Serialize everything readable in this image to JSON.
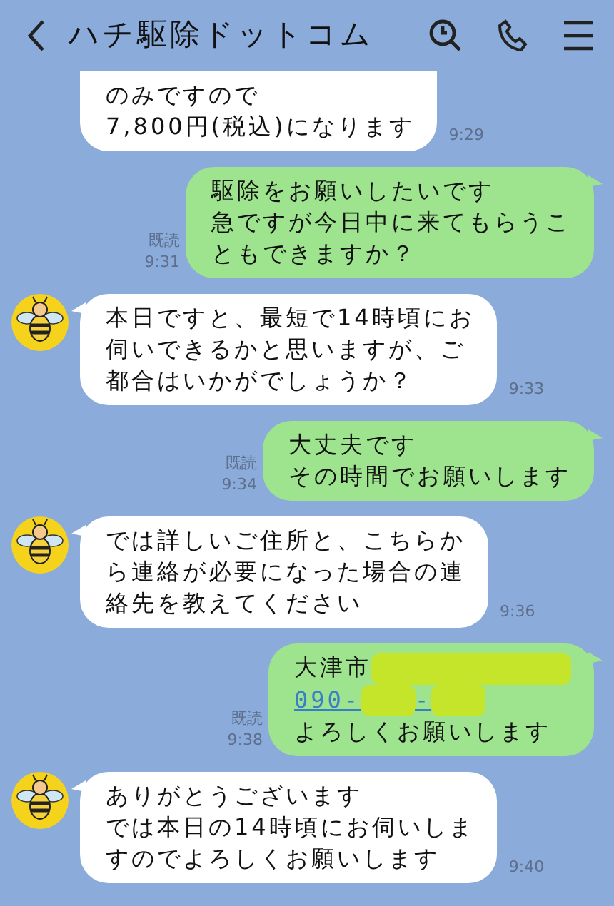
{
  "header": {
    "title": "ハチ駆除ドットコム"
  },
  "messages": [
    {
      "kind": "incoming",
      "avatar": false,
      "lines": [
        [
          {
            "kind": "text",
            "text": "のみですので"
          }
        ],
        [
          {
            "kind": "text",
            "text": "7,800円(税込)になります"
          }
        ]
      ],
      "time": "9:29"
    },
    {
      "kind": "outgoing",
      "read": "既読",
      "lines": [
        [
          {
            "kind": "text",
            "text": "駆除をお願いしたいです"
          }
        ],
        [
          {
            "kind": "text",
            "text": "急ですが今日中に来てもらうこ"
          }
        ],
        [
          {
            "kind": "text",
            "text": "ともできますか？"
          }
        ]
      ],
      "time": "9:31"
    },
    {
      "kind": "incoming",
      "avatar": true,
      "lines": [
        [
          {
            "kind": "text",
            "text": "本日ですと、最短で14時頃にお"
          }
        ],
        [
          {
            "kind": "text",
            "text": "伺いできるかと思いますが、ご"
          }
        ],
        [
          {
            "kind": "text",
            "text": "都合はいかがでしょうか？"
          }
        ]
      ],
      "time": "9:33"
    },
    {
      "kind": "outgoing",
      "read": "既読",
      "lines": [
        [
          {
            "kind": "text",
            "text": "大丈夫です"
          }
        ],
        [
          {
            "kind": "text",
            "text": "その時間でお願いします"
          }
        ]
      ],
      "time": "9:34"
    },
    {
      "kind": "incoming",
      "avatar": true,
      "lines": [
        [
          {
            "kind": "text",
            "text": "では詳しいご住所と、こちらか"
          }
        ],
        [
          {
            "kind": "text",
            "text": "ら連絡が必要になった場合の連"
          }
        ],
        [
          {
            "kind": "text",
            "text": "絡先を教えてください"
          }
        ]
      ],
      "time": "9:36"
    },
    {
      "kind": "outgoing",
      "read": "既読",
      "lines": [
        [
          {
            "kind": "text",
            "text": "大津市"
          },
          {
            "kind": "redacted"
          }
        ],
        [
          {
            "kind": "link",
            "text": "090-"
          },
          {
            "kind": "redacted"
          },
          {
            "kind": "link",
            "text": "-"
          },
          {
            "kind": "redacted"
          }
        ],
        [
          {
            "kind": "text",
            "text": "よろしくお願いします"
          }
        ]
      ],
      "time": "9:38"
    },
    {
      "kind": "incoming",
      "avatar": true,
      "lines": [
        [
          {
            "kind": "text",
            "text": "ありがとうございます"
          }
        ],
        [
          {
            "kind": "text",
            "text": "では本日の14時頃にお伺いしま"
          }
        ],
        [
          {
            "kind": "text",
            "text": "すのでよろしくお願いします"
          }
        ]
      ],
      "time": "9:40"
    }
  ]
}
